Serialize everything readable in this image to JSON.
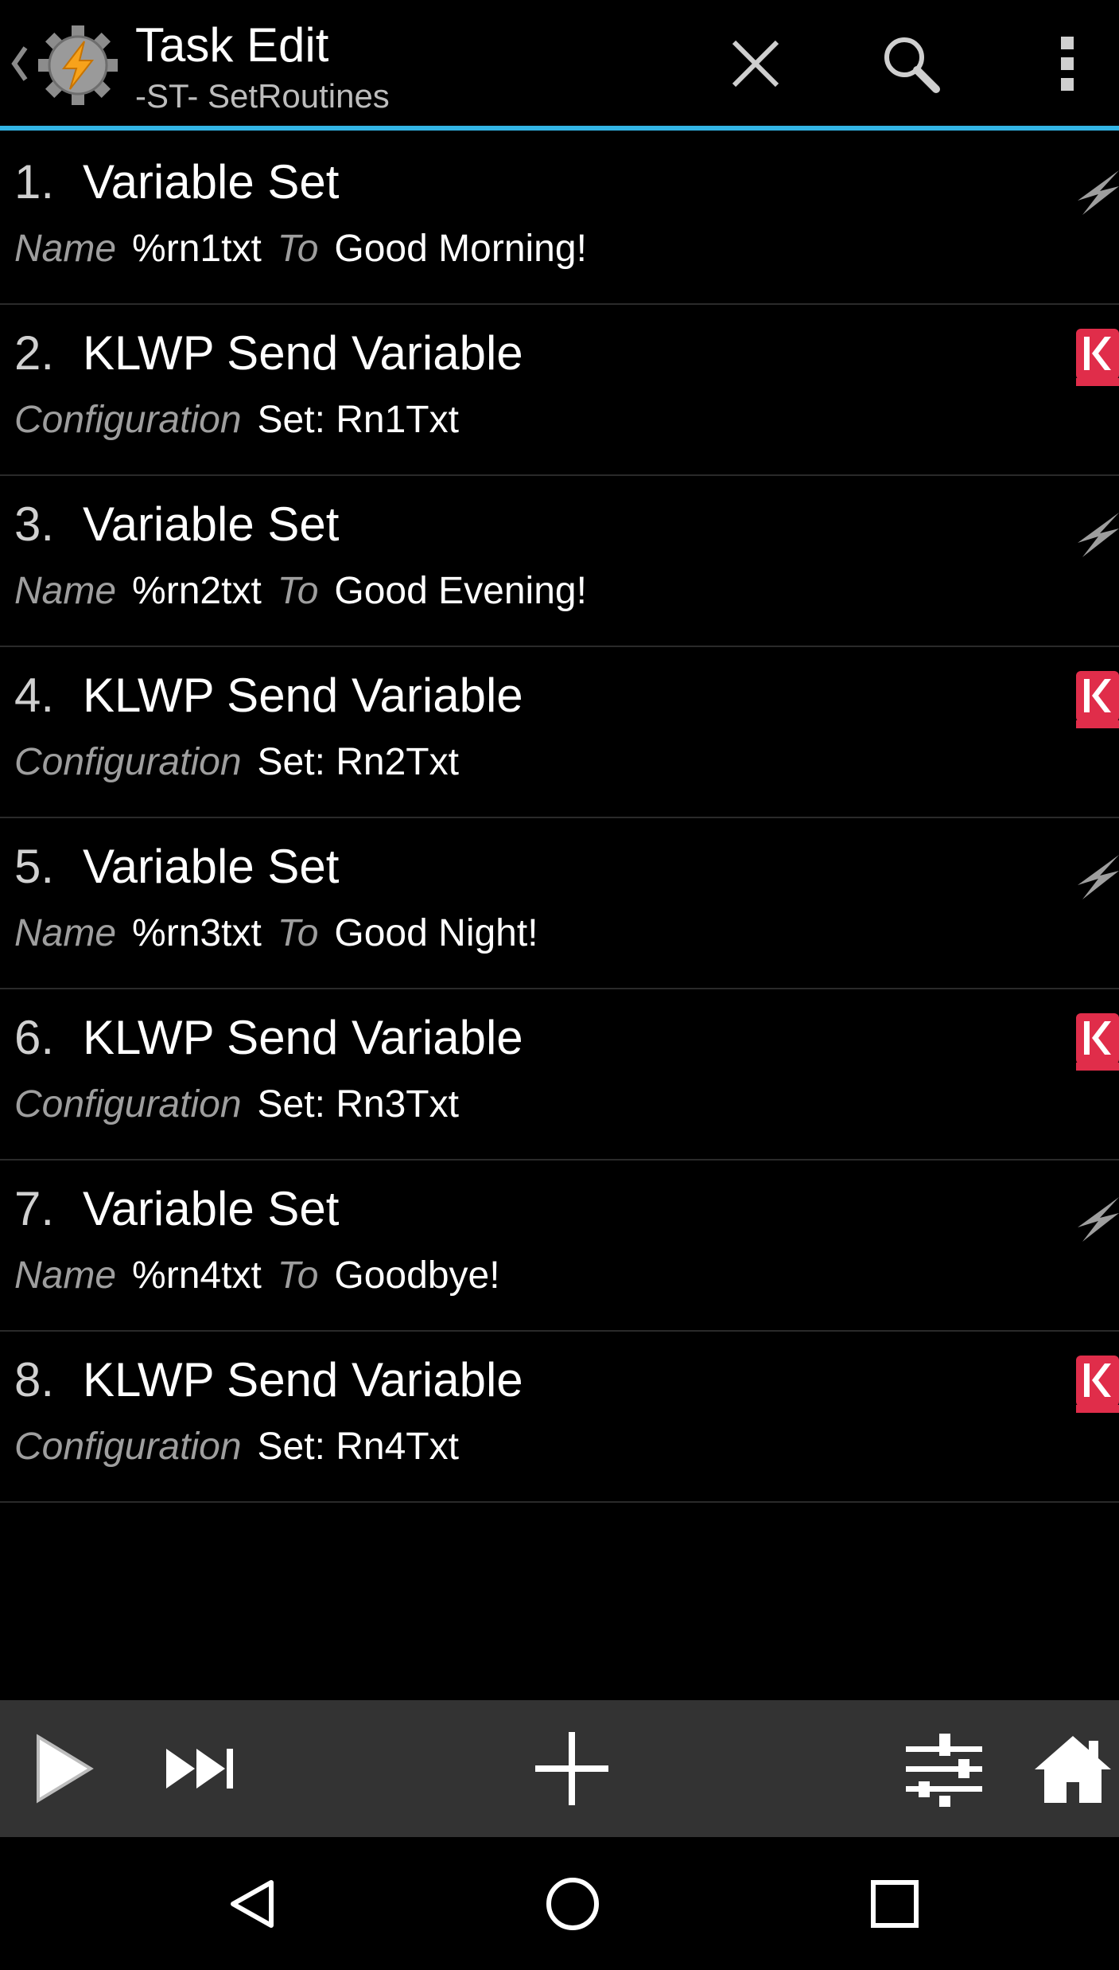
{
  "header": {
    "title": "Task Edit",
    "subtitle": "-ST- SetRoutines",
    "accent_color": "#33b5e5",
    "icons": {
      "up": "chevron-left-icon",
      "app": "tasker-app-icon",
      "close": "close-icon",
      "search": "search-icon",
      "overflow": "overflow-menu-icon"
    }
  },
  "actions": [
    {
      "num": "1.",
      "title": "Variable Set",
      "label1": "Name",
      "value1": "%rn1txt",
      "label2": "To",
      "value2": "Good Morning!",
      "icon": "plugin-bolt-icon"
    },
    {
      "num": "2.",
      "title": "KLWP Send Variable",
      "label1": "Configuration",
      "value1": "Set: Rn1Txt",
      "label2": "",
      "value2": "",
      "icon": "klwp-icon"
    },
    {
      "num": "3.",
      "title": "Variable Set",
      "label1": "Name",
      "value1": "%rn2txt",
      "label2": "To",
      "value2": "Good Evening!",
      "icon": "plugin-bolt-icon"
    },
    {
      "num": "4.",
      "title": "KLWP Send Variable",
      "label1": "Configuration",
      "value1": "Set: Rn2Txt",
      "label2": "",
      "value2": "",
      "icon": "klwp-icon"
    },
    {
      "num": "5.",
      "title": "Variable Set",
      "label1": "Name",
      "value1": "%rn3txt",
      "label2": "To",
      "value2": "Good Night!",
      "icon": "plugin-bolt-icon"
    },
    {
      "num": "6.",
      "title": "KLWP Send Variable",
      "label1": "Configuration",
      "value1": "Set: Rn3Txt",
      "label2": "",
      "value2": "",
      "icon": "klwp-icon"
    },
    {
      "num": "7.",
      "title": "Variable Set",
      "label1": "Name",
      "value1": "%rn4txt",
      "label2": "To",
      "value2": "Goodbye!",
      "icon": "plugin-bolt-icon"
    },
    {
      "num": "8.",
      "title": "KLWP Send Variable",
      "label1": "Configuration",
      "value1": "Set: Rn4Txt",
      "label2": "",
      "value2": "",
      "icon": "klwp-icon"
    }
  ],
  "toolbar": {
    "icons": [
      "play-icon",
      "step-forward-icon",
      "add-icon",
      "properties-icon",
      "home-icon"
    ]
  },
  "navbar": {
    "icons": [
      "back-icon",
      "home-circle-icon",
      "recents-icon"
    ]
  }
}
